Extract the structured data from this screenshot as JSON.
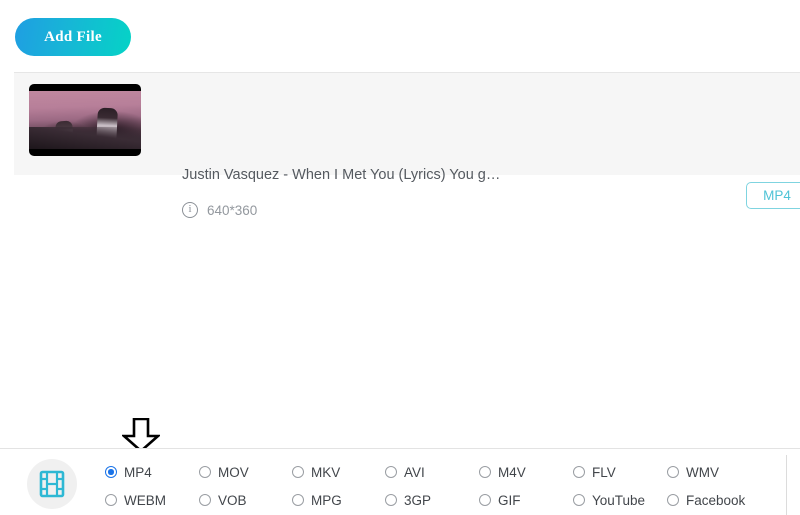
{
  "toolbar": {
    "add_file_label": "Add File"
  },
  "file_list": {
    "items": [
      {
        "title": "Justin Vasquez - When I Met You (Lyrics) You g…",
        "resolution": "640*360",
        "output_format": "MP4",
        "info_glyph": "i",
        "thumbnail_name": "video-thumbnail"
      }
    ]
  },
  "annotation": {
    "arrow_name": "down-arrow-annotation",
    "arrow_color": "#000000"
  },
  "format_bar": {
    "icon_name": "film-strip-icon",
    "icon_color": "#2eb8d4",
    "selected_format": "MP4",
    "accent_color": "#1a73e8",
    "options": [
      {
        "label": "MP4",
        "checked": true
      },
      {
        "label": "MOV",
        "checked": false
      },
      {
        "label": "MKV",
        "checked": false
      },
      {
        "label": "AVI",
        "checked": false
      },
      {
        "label": "M4V",
        "checked": false
      },
      {
        "label": "FLV",
        "checked": false
      },
      {
        "label": "WMV",
        "checked": false
      },
      {
        "label": "WEBM",
        "checked": false
      },
      {
        "label": "VOB",
        "checked": false
      },
      {
        "label": "MPG",
        "checked": false
      },
      {
        "label": "3GP",
        "checked": false
      },
      {
        "label": "GIF",
        "checked": false
      },
      {
        "label": "YouTube",
        "checked": false
      },
      {
        "label": "Facebook",
        "checked": false
      }
    ]
  },
  "colors": {
    "button_gradient_start": "#1f9ee2",
    "button_gradient_end": "#05d3c6",
    "badge_border": "#7fd4e0",
    "row_background": "#f6f6f6"
  }
}
